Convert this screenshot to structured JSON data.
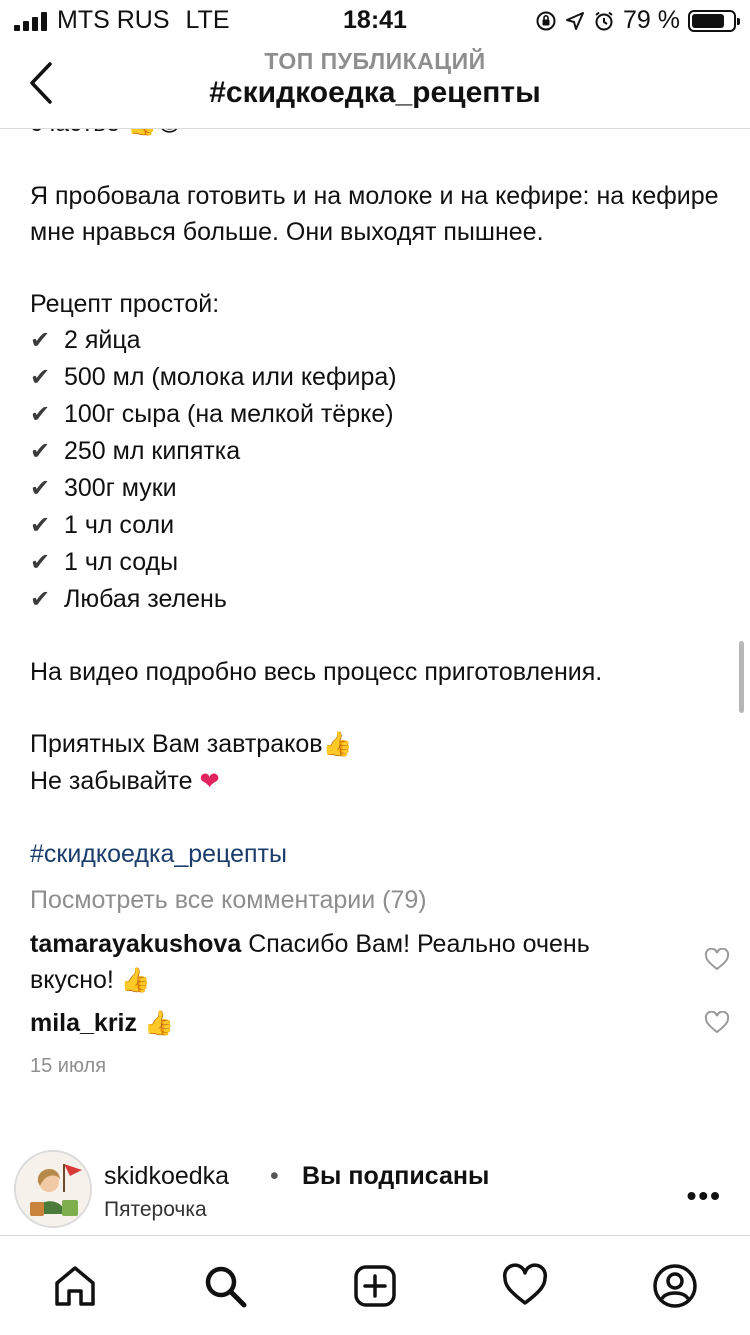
{
  "status_bar": {
    "carrier": "MTS RUS",
    "network": "LTE",
    "time": "18:41",
    "battery_text": "79 %",
    "battery_level": 0.79
  },
  "header": {
    "subtitle": "ТОП ПУБЛИКАЦИЙ",
    "title": "#скидкоедка_рецепты",
    "back_icon": "chevron-left-icon"
  },
  "caption": {
    "line_top": "счастье",
    "paragraph1": "Я пробовала готовить и на молоке и на кефире: на кефире мне нравься больше. Они выходят пышнее.",
    "recipe_title": "Рецепт простой:",
    "ingredients": [
      "2 яйца",
      "500 мл (молока или кефира)",
      "100г сыра (на мелкой тёрке)",
      "250 мл кипятка",
      "300г муки",
      "1 чл соли",
      "1 чл соды",
      "Любая зелень"
    ],
    "video_note": "На видео подробно весь процесс приготовления.",
    "closing1": "Приятных Вам завтраков",
    "closing2": "Не забывайте",
    "hashtag": "#скидкоедка_рецепты"
  },
  "comments": {
    "view_all": "Посмотреть все комментарии (79)",
    "items": [
      {
        "user": "tamarayakushova",
        "text": "Спасибо Вам! Реально очень вкусно!"
      },
      {
        "user": "mila_kriz",
        "text": ""
      }
    ],
    "date": "15 июля"
  },
  "author": {
    "name": "skidkoedka",
    "separator": "•",
    "status": "Вы подписаны",
    "location": "Пятерочка",
    "more": "•••"
  },
  "colors": {
    "hashtag": "#1a3d6b",
    "muted": "#8e8e8e",
    "divider": "#dbdbdb"
  },
  "tab_bar": {
    "icons": [
      "home-icon",
      "search-icon",
      "new-post-icon",
      "activity-heart-icon",
      "profile-icon"
    ]
  }
}
